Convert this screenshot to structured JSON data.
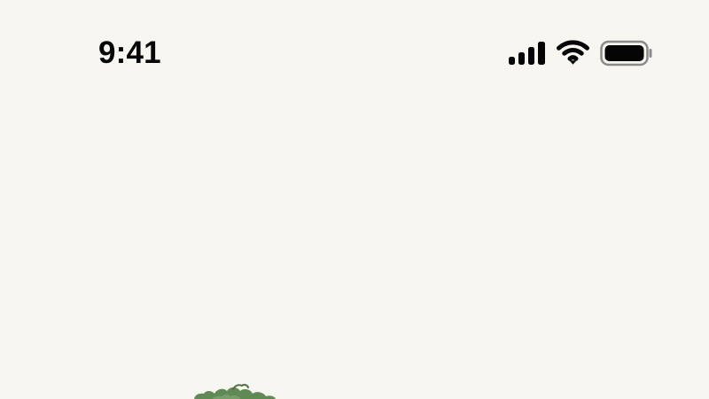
{
  "status_bar": {
    "time": "9:41",
    "icons": {
      "signal": "cellular-signal-icon",
      "wifi": "wifi-icon",
      "battery": "battery-icon"
    }
  },
  "colors": {
    "background": "#f8f6f1",
    "status_text": "#050505",
    "plant_green": "#5f8a55"
  },
  "content": {
    "illustration": "plant-illustration"
  }
}
